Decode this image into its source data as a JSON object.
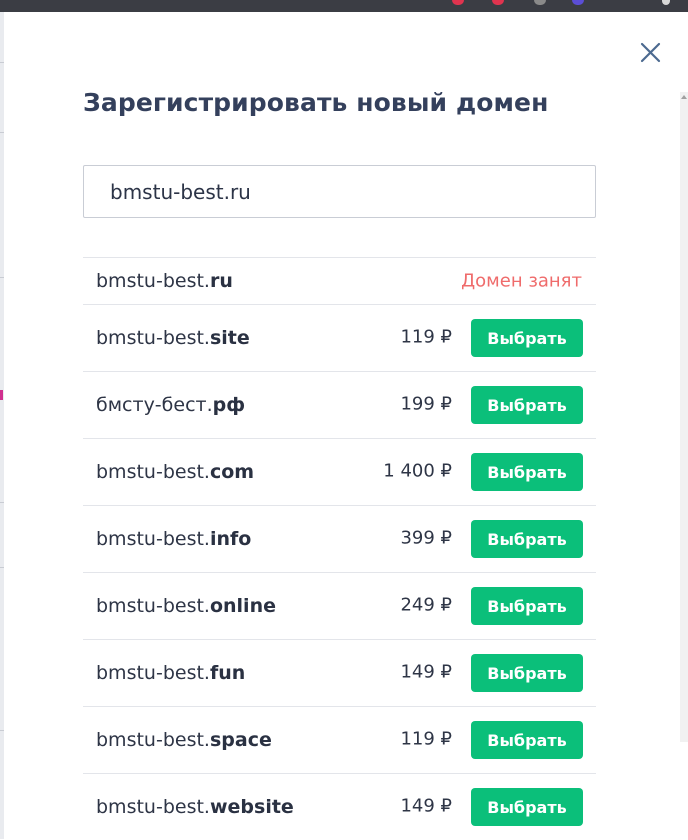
{
  "dialog": {
    "title": "Зарегистрировать новый домен",
    "search": {
      "value": "bmstu-best.ru"
    },
    "taken_row": {
      "name": "bmstu-best.",
      "zone": "ru",
      "status": "Домен занят"
    },
    "select_label": "Выбрать",
    "options": [
      {
        "name": "bmstu-best.",
        "zone": "site",
        "price": "119 ₽"
      },
      {
        "name": "бмсту-бест.",
        "zone": "рф",
        "price": "199 ₽"
      },
      {
        "name": "bmstu-best.",
        "zone": "com",
        "price": "1 400 ₽"
      },
      {
        "name": "bmstu-best.",
        "zone": "info",
        "price": "399 ₽"
      },
      {
        "name": "bmstu-best.",
        "zone": "online",
        "price": "249 ₽"
      },
      {
        "name": "bmstu-best.",
        "zone": "fun",
        "price": "149 ₽"
      },
      {
        "name": "bmstu-best.",
        "zone": "space",
        "price": "119 ₽"
      },
      {
        "name": "bmstu-best.",
        "zone": "website",
        "price": "149 ₽"
      }
    ]
  },
  "colors": {
    "accent_button": "#0bbf7a",
    "taken_text": "#ef6b6b",
    "title_text": "#34405c"
  },
  "icons": {
    "close": "close-icon"
  }
}
